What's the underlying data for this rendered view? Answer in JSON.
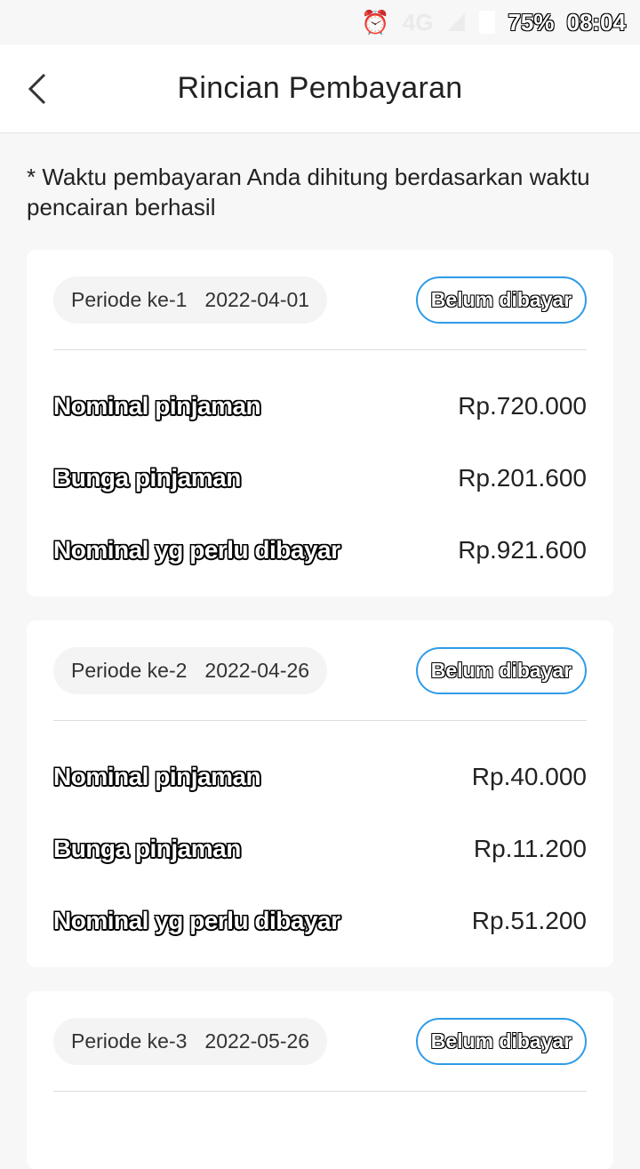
{
  "status_bar": {
    "alarm_icon": "alarm-icon",
    "network": "4G",
    "signal_icon": "signal-icon",
    "battery_icon": "battery-icon",
    "battery": "75%",
    "time": "08:04"
  },
  "header": {
    "back_icon": "chevron-left-icon",
    "title": "Rincian Pembayaran"
  },
  "note": "* Waktu pembayaran Anda dihitung berdasarkan waktu pencairan berhasil",
  "periods": [
    {
      "period_label": "Periode ke-1",
      "date": "2022-04-01",
      "status": "Belum dibayar",
      "rows": [
        {
          "label": "Nominal pinjaman",
          "value": "Rp.720.000"
        },
        {
          "label": "Bunga pinjaman",
          "value": "Rp.201.600"
        },
        {
          "label": "Nominal yg perlu dibayar",
          "value": "Rp.921.600"
        }
      ]
    },
    {
      "period_label": "Periode ke-2",
      "date": "2022-04-26",
      "status": "Belum dibayar",
      "rows": [
        {
          "label": "Nominal pinjaman",
          "value": "Rp.40.000"
        },
        {
          "label": "Bunga pinjaman",
          "value": "Rp.11.200"
        },
        {
          "label": "Nominal yg perlu dibayar",
          "value": "Rp.51.200"
        }
      ]
    },
    {
      "period_label": "Periode ke-3",
      "date": "2022-05-26",
      "status": "Belum dibayar",
      "rows": []
    }
  ],
  "colors": {
    "accent": "#2f9be8",
    "background": "#f7f7f7",
    "card": "#ffffff"
  }
}
